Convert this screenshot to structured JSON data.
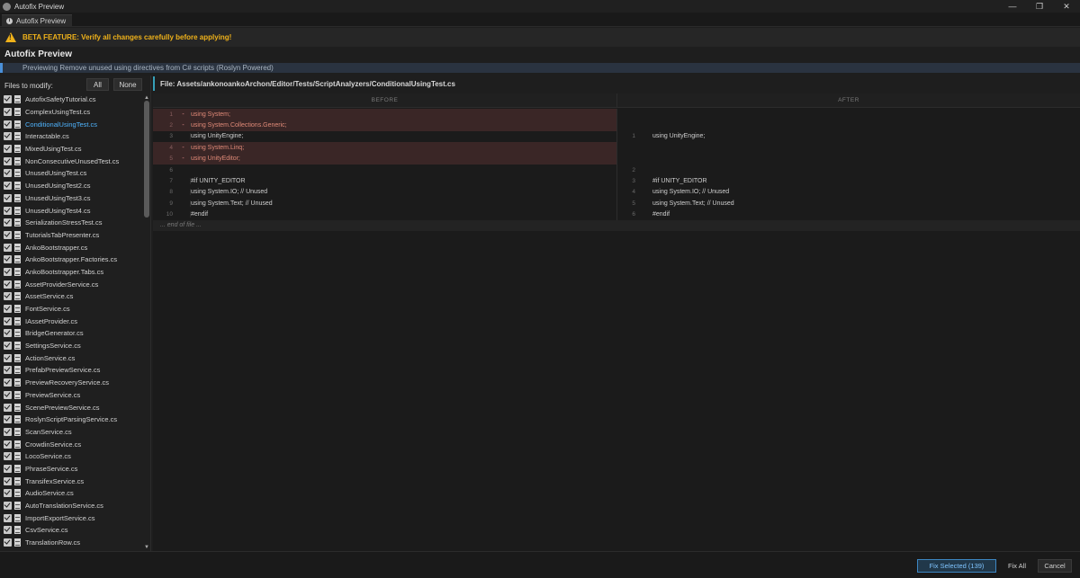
{
  "window": {
    "title": "Autofix Preview",
    "controls": {
      "minimize": "—",
      "restore": "❐",
      "close": "✕"
    }
  },
  "tab": {
    "label": "Autofix Preview"
  },
  "banner": {
    "text": "BETA FEATURE: Verify all changes carefully before applying!",
    "color": "#f0b21a"
  },
  "header": {
    "title": "Autofix Preview",
    "description": "Previewing Remove unused using directives from C# scripts (Roslyn Powered)"
  },
  "sidebar": {
    "label": "Files to modify:",
    "all_label": "All",
    "none_label": "None",
    "files": [
      "AutofixSafetyTutorial.cs",
      "ComplexUsingTest.cs",
      "ConditionalUsingTest.cs",
      "Interactable.cs",
      "MixedUsingTest.cs",
      "NonConsecutiveUnusedTest.cs",
      "UnusedUsingTest.cs",
      "UnusedUsingTest2.cs",
      "UnusedUsingTest3.cs",
      "UnusedUsingTest4.cs",
      "SerializationStressTest.cs",
      "TutorialsTabPresenter.cs",
      "AnkoBootstrapper.cs",
      "AnkoBootstrapper.Factories.cs",
      "AnkoBootstrapper.Tabs.cs",
      "AssetProviderService.cs",
      "AssetService.cs",
      "FontService.cs",
      "IAssetProvider.cs",
      "BridgeGenerator.cs",
      "SettingsService.cs",
      "ActionService.cs",
      "PrefabPreviewService.cs",
      "PreviewRecoveryService.cs",
      "PreviewService.cs",
      "ScenePreviewService.cs",
      "RoslynScriptParsingService.cs",
      "ScanService.cs",
      "CrowdinService.cs",
      "LocoService.cs",
      "PhraseService.cs",
      "TransifexService.cs",
      "AudioService.cs",
      "AutoTranslationService.cs",
      "ImportExportService.cs",
      "CsvService.cs",
      "TranslationRow.cs"
    ],
    "selected_index": 2,
    "selected_color": "#4fb4ff"
  },
  "diff": {
    "file_path": "File: Assets/ankonoankoArchon/Editor/Tests/ScriptAnalyzers/ConditionalUsingTest.cs",
    "before_label": "BEFORE",
    "after_label": "AFTER",
    "before_lines": [
      {
        "num": "1",
        "marker": "-",
        "code": "using System;",
        "removed": true
      },
      {
        "num": "2",
        "marker": "-",
        "code": "using System.Collections.Generic;",
        "removed": true
      },
      {
        "num": "3",
        "marker": "",
        "code": "using UnityEngine;",
        "removed": false
      },
      {
        "num": "4",
        "marker": "-",
        "code": "using System.Linq;",
        "removed": true
      },
      {
        "num": "5",
        "marker": "-",
        "code": "using UnityEditor;",
        "removed": true
      },
      {
        "num": "6",
        "marker": "",
        "code": "",
        "removed": false
      },
      {
        "num": "7",
        "marker": "",
        "code": "#if UNITY_EDITOR",
        "removed": false
      },
      {
        "num": "8",
        "marker": "",
        "code": "using System.IO; // Unused",
        "removed": false
      },
      {
        "num": "9",
        "marker": "",
        "code": "using System.Text; // Unused",
        "removed": false
      },
      {
        "num": "10",
        "marker": "",
        "code": "#endif",
        "removed": false
      }
    ],
    "after_lines": [
      {
        "num": "",
        "code": ""
      },
      {
        "num": "",
        "code": ""
      },
      {
        "num": "1",
        "code": "using UnityEngine;"
      },
      {
        "num": "",
        "code": ""
      },
      {
        "num": "",
        "code": ""
      },
      {
        "num": "2",
        "code": ""
      },
      {
        "num": "3",
        "code": "#if UNITY_EDITOR"
      },
      {
        "num": "4",
        "code": "using System.IO; // Unused"
      },
      {
        "num": "5",
        "code": "using System.Text; // Unused"
      },
      {
        "num": "6",
        "code": "#endif"
      }
    ],
    "eof_label": "... end of file ..."
  },
  "footer": {
    "fix_selected_label": "Fix Selected (139)",
    "fix_all_label": "Fix All",
    "cancel_label": "Cancel"
  }
}
